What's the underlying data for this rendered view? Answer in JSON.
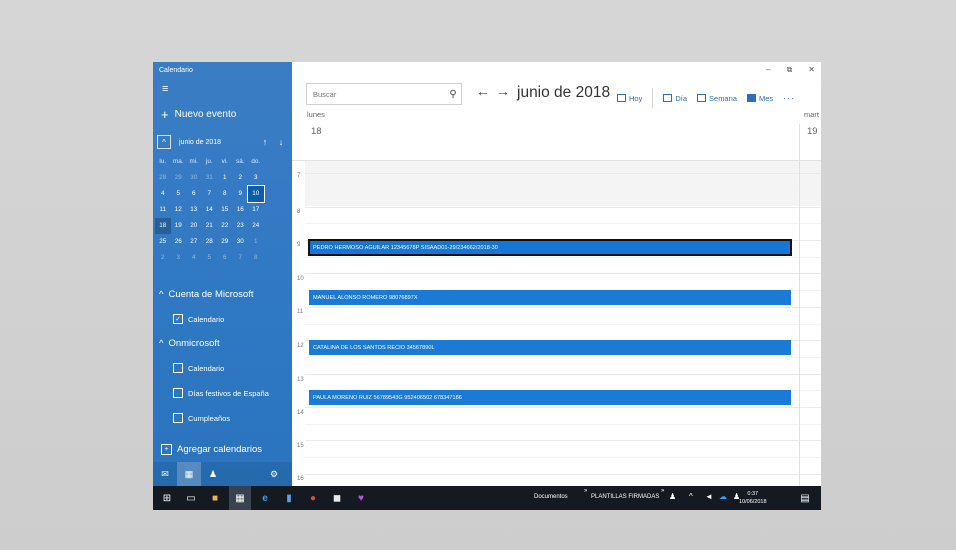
{
  "app": {
    "title": "Calendario"
  },
  "sidebar": {
    "new_event": "Nuevo evento",
    "mini_calendar": {
      "month": "junio de 2018",
      "weekdays": [
        "lu.",
        "ma.",
        "mi.",
        "ju.",
        "vi.",
        "sá.",
        "do."
      ],
      "weeks": [
        [
          "28",
          "29",
          "30",
          "31",
          "1",
          "2",
          "3"
        ],
        [
          "4",
          "5",
          "6",
          "7",
          "8",
          "9",
          "10"
        ],
        [
          "11",
          "12",
          "13",
          "14",
          "15",
          "16",
          "17"
        ],
        [
          "18",
          "19",
          "20",
          "21",
          "22",
          "23",
          "24"
        ],
        [
          "25",
          "26",
          "27",
          "28",
          "29",
          "30",
          "1"
        ],
        [
          "2",
          "3",
          "4",
          "5",
          "6",
          "7",
          "8"
        ]
      ]
    },
    "accounts": [
      {
        "name": "Cuenta de Microsoft",
        "calendars": [
          {
            "name": "Calendario",
            "checked": true
          }
        ]
      },
      {
        "name": "Onmicrosoft",
        "calendars": [
          {
            "name": "Calendario",
            "checked": false
          },
          {
            "name": "Días festivos de España",
            "checked": false
          },
          {
            "name": "Cumpleaños",
            "checked": false
          }
        ]
      }
    ],
    "add_calendars": "Agregar calendarios"
  },
  "toolbar": {
    "search_placeholder": "Buscar",
    "month_title": "junio de 2018",
    "today": "Hoy",
    "day": "Día",
    "week": "Semana",
    "month": "Mes",
    "more": "···"
  },
  "window_controls": {
    "minimize": "–",
    "restore": "⧉",
    "close": "✕"
  },
  "day_view": {
    "day_name": "lunes",
    "day_number": "18",
    "next_day_name": "mart",
    "next_day_number": "19",
    "hours": [
      "7",
      "8",
      "9",
      "10",
      "11",
      "12",
      "13",
      "14",
      "15",
      "16"
    ],
    "events": [
      {
        "title": "PEDRO HERMOSO AGUILAR 12345678P SISAAD01-29/234662/2018-30",
        "hour": "9",
        "selected": true
      },
      {
        "title": "MANUEL ALONSO ROMERO 98076897X",
        "hour": "10"
      },
      {
        "title": "CATALINA DE LOS SANTOS RECIO 34567890L",
        "hour": "12"
      },
      {
        "title": "PAULA MORENO RUIZ 56789543G 952406502 678347186",
        "hour": "13"
      }
    ]
  },
  "taskbar": {
    "toolbar_1": "Documentos",
    "toolbar_2": "PLANTILLAS FIRMADAS",
    "time": "0:37",
    "date": "10/06/2018"
  }
}
